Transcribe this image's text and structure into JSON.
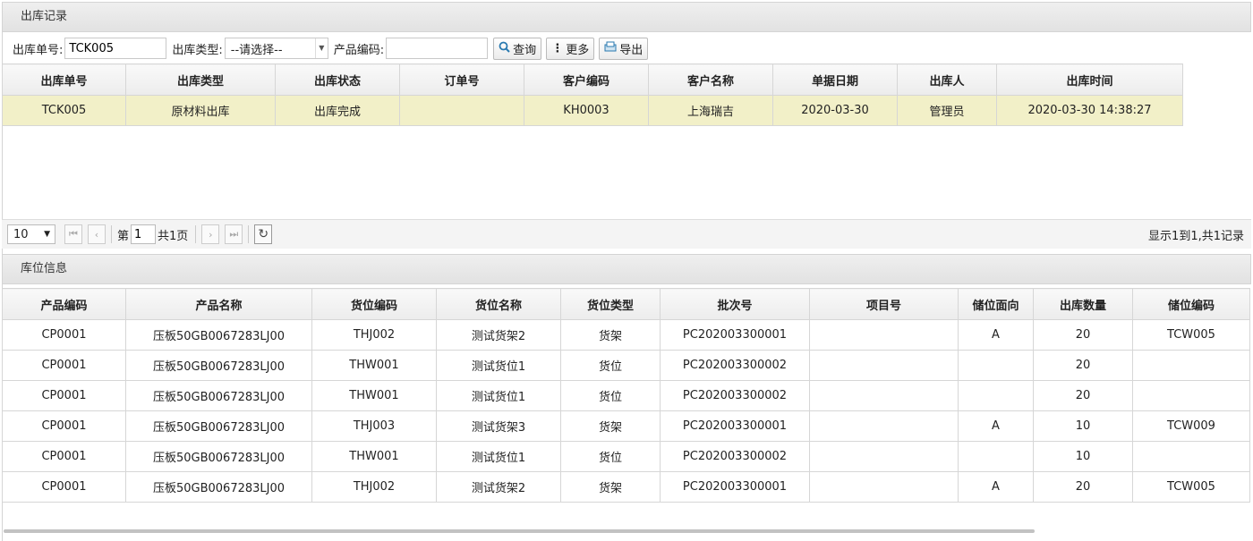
{
  "outbound_panel": {
    "title": "出库记录"
  },
  "filters": {
    "order_no_label": "出库单号:",
    "order_no_value": "TCK005",
    "type_label": "出库类型:",
    "type_value": "--请选择--",
    "product_code_label": "产品编码:",
    "product_code_value": "",
    "query_label": "查询",
    "more_label": "更多",
    "export_label": "导出"
  },
  "outbound_table": {
    "columns": [
      "出库单号",
      "出库类型",
      "出库状态",
      "订单号",
      "客户编码",
      "客户名称",
      "单据日期",
      "出库人",
      "出库时间"
    ],
    "rows": [
      [
        "TCK005",
        "原材料出库",
        "出库完成",
        "",
        "KH0003",
        "上海瑞吉",
        "2020-03-30",
        "管理员",
        "2020-03-30 14:38:27"
      ]
    ]
  },
  "pager": {
    "page_size": "10",
    "page_prefix": "第",
    "page_value": "1",
    "page_total": "共1页",
    "info": "显示1到1,共1记录"
  },
  "location_panel": {
    "title": "库位信息"
  },
  "location_table": {
    "columns": [
      "产品编码",
      "产品名称",
      "货位编码",
      "货位名称",
      "货位类型",
      "批次号",
      "项目号",
      "储位面向",
      "出库数量",
      "储位编码"
    ],
    "rows": [
      [
        "CP0001",
        "压板50GB0067283LJ00",
        "THJ002",
        "测试货架2",
        "货架",
        "PC202003300001",
        "",
        "A",
        "20",
        "TCW005"
      ],
      [
        "CP0001",
        "压板50GB0067283LJ00",
        "THW001",
        "测试货位1",
        "货位",
        "PC202003300002",
        "",
        "",
        "20",
        ""
      ],
      [
        "CP0001",
        "压板50GB0067283LJ00",
        "THW001",
        "测试货位1",
        "货位",
        "PC202003300002",
        "",
        "",
        "20",
        ""
      ],
      [
        "CP0001",
        "压板50GB0067283LJ00",
        "THJ003",
        "测试货架3",
        "货架",
        "PC202003300001",
        "",
        "A",
        "10",
        "TCW009"
      ],
      [
        "CP0001",
        "压板50GB0067283LJ00",
        "THW001",
        "测试货位1",
        "货位",
        "PC202003300002",
        "",
        "",
        "10",
        ""
      ],
      [
        "CP0001",
        "压板50GB0067283LJ00",
        "THJ002",
        "测试货架2",
        "货架",
        "PC202003300001",
        "",
        "A",
        "20",
        "TCW005"
      ]
    ]
  },
  "icons": {
    "query": "search-icon",
    "more": "vertical-dots-icon",
    "export": "export-icon",
    "refresh": "refresh-icon",
    "accent": "#2a7ab0"
  }
}
